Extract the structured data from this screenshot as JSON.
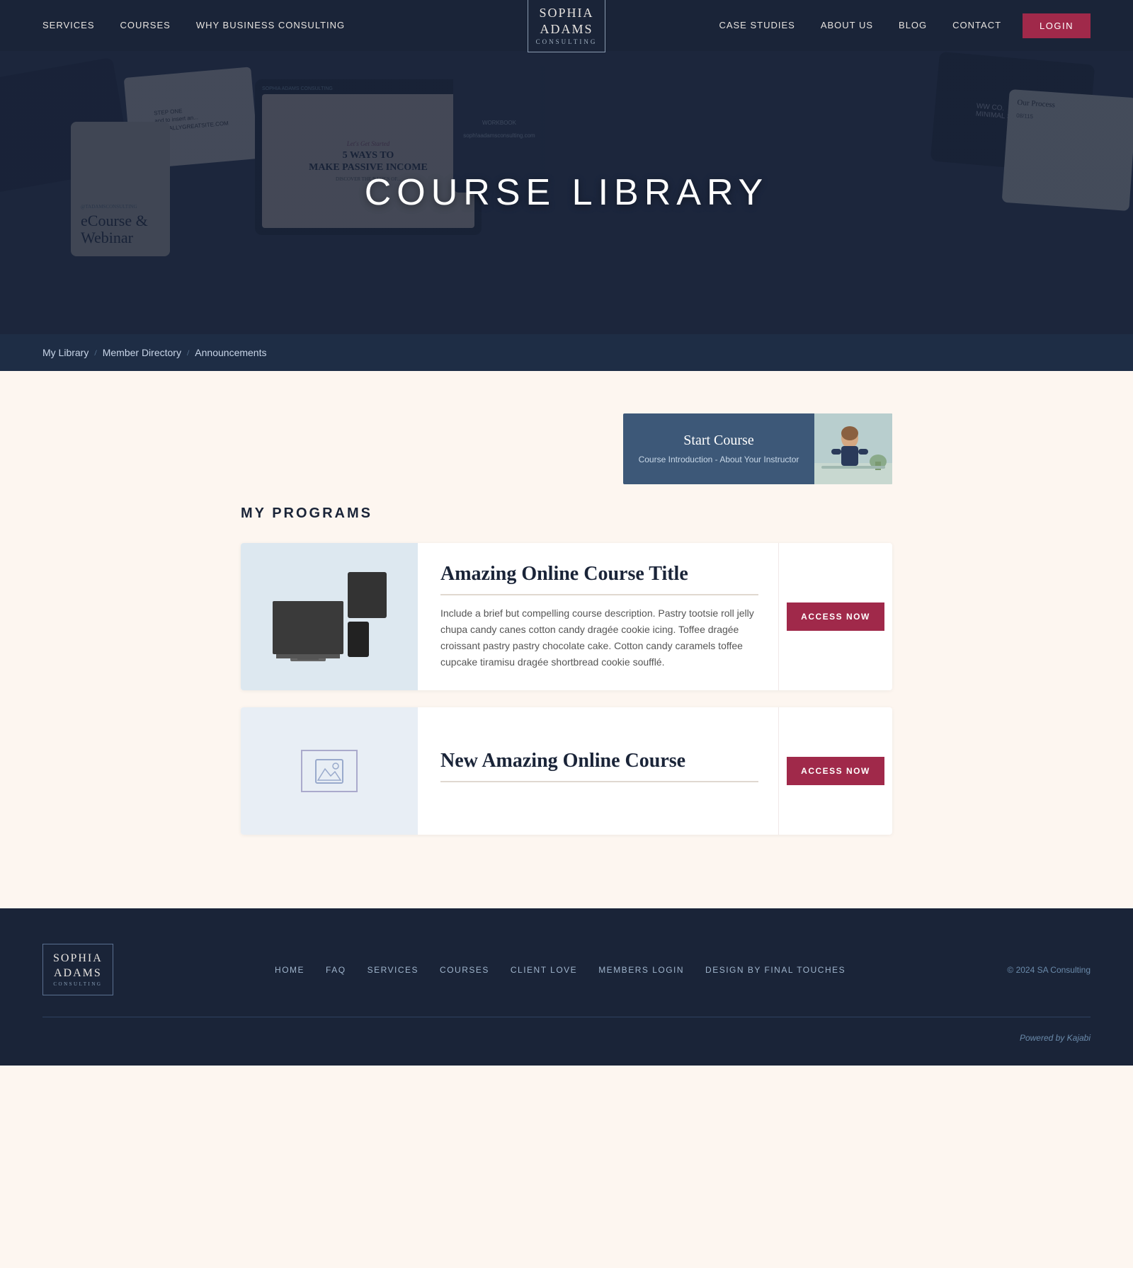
{
  "nav": {
    "links_left": [
      {
        "label": "SERVICES",
        "href": "#"
      },
      {
        "label": "COURSES",
        "href": "#"
      },
      {
        "label": "WHY BUSINESS CONSULTING",
        "href": "#"
      }
    ],
    "logo": {
      "line1": "SOPHIA",
      "line2": "ADAMS",
      "sub": "CONSULTING"
    },
    "links_right": [
      {
        "label": "CASE STUDIES",
        "href": "#"
      },
      {
        "label": "ABOUT US",
        "href": "#"
      },
      {
        "label": "BLOG",
        "href": "#"
      },
      {
        "label": "CONTACT",
        "href": "#"
      }
    ],
    "login_label": "LOGIN"
  },
  "hero": {
    "title": "COURSE LIBRARY"
  },
  "sub_nav": {
    "items": [
      {
        "label": "My Library"
      },
      {
        "label": "Member Directory"
      },
      {
        "label": "Announcements"
      }
    ]
  },
  "programs": {
    "section_title": "MY PROGRAMS",
    "start_course": {
      "label": "Start Course",
      "subtitle": "Course Introduction - About Your Instructor"
    },
    "courses": [
      {
        "title": "Amazing Online Course Title",
        "description": "Include a brief but compelling course description. Pastry tootsie roll jelly chupa candy canes cotton candy dragée cookie icing. Toffee dragée croissant pastry pastry chocolate cake. Cotton candy caramels toffee cupcake tiramisu dragée shortbread cookie soufflé.",
        "button_label": "ACCESS NOW",
        "has_image": true
      },
      {
        "title": "New Amazing Online Course",
        "description": "",
        "button_label": "ACCESS NOW",
        "has_image": false
      }
    ]
  },
  "footer": {
    "logo": {
      "line1": "SOPHIA",
      "line2": "ADAMS",
      "sub": "CONSULTING"
    },
    "nav_links": [
      {
        "label": "HOME"
      },
      {
        "label": "FAQ"
      },
      {
        "label": "SERVICES"
      },
      {
        "label": "COURSES"
      },
      {
        "label": "CLIENT LOVE"
      },
      {
        "label": "MEMBERS LOGIN"
      },
      {
        "label": "Design By Final Touches"
      }
    ],
    "copyright": "© 2024 SA Consulting",
    "powered": "Powered by Kajabi"
  }
}
